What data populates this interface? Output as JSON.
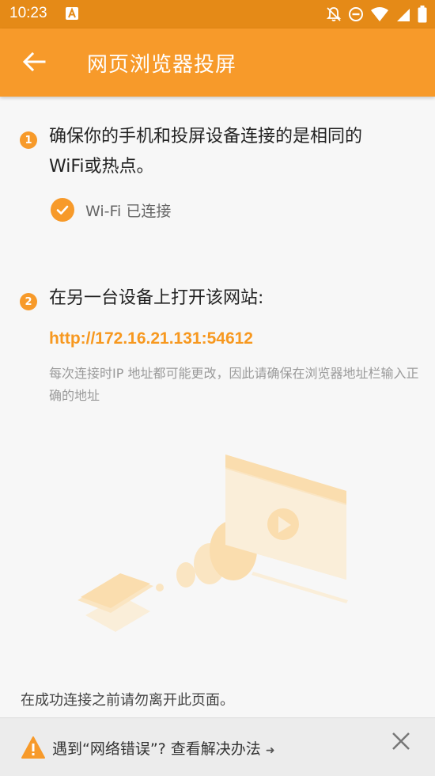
{
  "status_bar": {
    "time": "10:23"
  },
  "app_bar": {
    "title": "网页浏览器投屏"
  },
  "step1": {
    "number": "1",
    "text_line1": "确保你的手机和投屏设备连接的是相同的",
    "text_line2": "WiFi或热点。",
    "wifi_status": "Wi-Fi 已连接"
  },
  "step2": {
    "number": "2",
    "text": "在另一台设备上打开该网站:",
    "url": "http://172.16.21.131:54612",
    "hint": "每次连接时IP 地址都可能更改，因此请确保在浏览器地址栏输入正确的地址"
  },
  "leave_note": "在成功连接之前请勿离开此页面。",
  "bottom": {
    "message": "遇到“网络错误”? 查看解决办法",
    "arrow": "➜"
  },
  "colors": {
    "accent": "#f79a2a",
    "status_bar": "#e58a17",
    "url": "#f7981f"
  }
}
